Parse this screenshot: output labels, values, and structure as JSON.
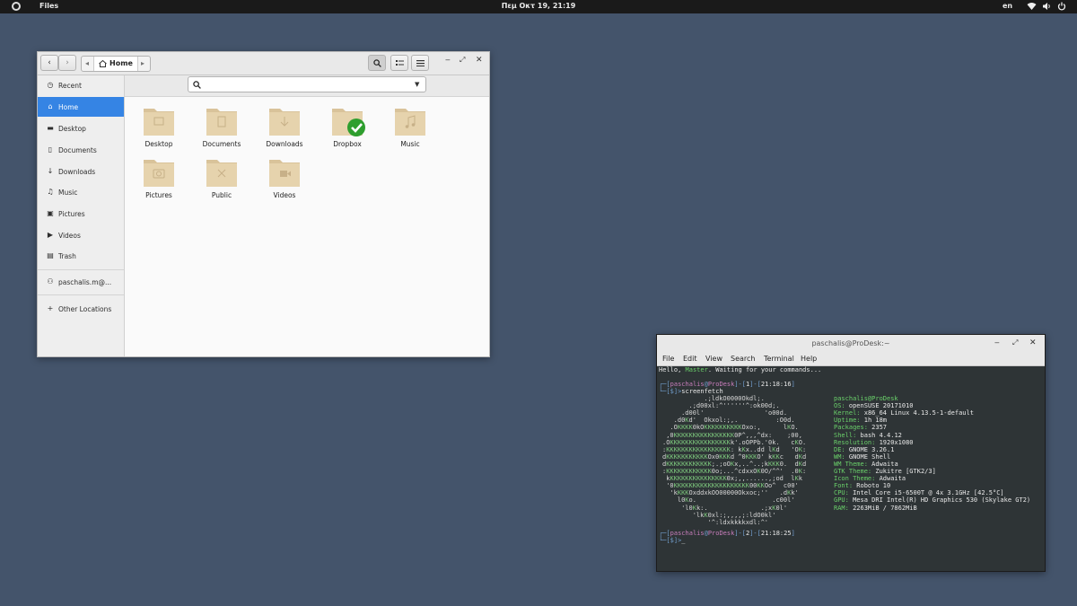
{
  "topbar": {
    "app": "Files",
    "clock": "Πεμ Οκτ 19, 21:19",
    "lang": "en",
    "icons": [
      "activities-icon",
      "network-icon",
      "volume-icon",
      "power-icon"
    ]
  },
  "files": {
    "path_label": "Home",
    "sidebar": [
      {
        "label": "Recent",
        "icon": "clock-icon"
      },
      {
        "label": "Home",
        "icon": "home-icon",
        "active": true
      },
      {
        "label": "Desktop",
        "icon": "desktop-icon"
      },
      {
        "label": "Documents",
        "icon": "document-icon"
      },
      {
        "label": "Downloads",
        "icon": "download-icon"
      },
      {
        "label": "Music",
        "icon": "music-icon"
      },
      {
        "label": "Pictures",
        "icon": "camera-icon"
      },
      {
        "label": "Videos",
        "icon": "video-icon"
      },
      {
        "label": "Trash",
        "icon": "trash-icon"
      },
      {
        "label": "paschalis.m@...",
        "icon": "network-drive-icon"
      },
      {
        "label": "Other Locations",
        "icon": "plus-icon"
      }
    ],
    "folders": [
      {
        "label": "Desktop",
        "icon": "desktop-folder-icon"
      },
      {
        "label": "Documents",
        "icon": "documents-folder-icon"
      },
      {
        "label": "Downloads",
        "icon": "downloads-folder-icon"
      },
      {
        "label": "Dropbox",
        "icon": "dropbox-folder-icon"
      },
      {
        "label": "Music",
        "icon": "music-folder-icon"
      },
      {
        "label": "Pictures",
        "icon": "pictures-folder-icon"
      },
      {
        "label": "Public",
        "icon": "public-folder-icon"
      },
      {
        "label": "Videos",
        "icon": "videos-folder-icon"
      }
    ],
    "colors": {
      "accent": "#3584e4",
      "folder": "#e3cfa9",
      "check": "#2e9e2e"
    }
  },
  "terminal": {
    "title": "paschalis@ProDesk:~",
    "menu": [
      "File",
      "Edit",
      "View",
      "Search",
      "Terminal",
      "Help"
    ],
    "greeting": {
      "pre": "Hello, ",
      "name": "Master",
      "post": ". Waiting for your commands..."
    },
    "prompt1": {
      "user": "paschalis",
      "host": "ProDesk",
      "num": "1",
      "time": "21:18:16",
      "cmd": "screenfetch"
    },
    "prompt2": {
      "user": "paschalis",
      "host": "ProDesk",
      "num": "2",
      "time": "21:18:25",
      "cmd": "_"
    },
    "logo": [
      "           .;ldkO0000Okdl;.",
      "       .;d00xl:^''''''^:ok00d;.",
      "     .d00l'                'o00d.",
      "   .d0Kd'  Okxol:;,.          :O0d.",
      "  .OKKKK0kOKKKKKKKKKKOxo:,      lKO.",
      " ,0KKKKKKKKKKKKKKKK0P^,,,^dx:    ;00,",
      ".OKKKKKKKKKKKKKKKKk'.oOPPb.'0k.   cKO.",
      ":KKKKKKKKKKKKKKKKK: kKx..dd lKd   'OK:",
      "dKKKKKKKKKKKOx0KKKd ^0KKKO' kKKc   dKd",
      "dKKKKKKKKKKKK;.;oOKx,..^..;kKKK0.  dKd",
      ":KKKKKKKKKKKK0o;...^cdxxOK0O/^^'  .0K:",
      " kKKKKKKKKKKKKKKK0x;,,......,;od  lKk",
      " '0KKKKKKKKKKKKKKKKKKKK00KKOo^  c00'",
      "  'kKKKOxddxkOO00000Okxoc;''   .dKk'",
      "    l0Ko.                    .c00l'",
      "     'l0Kk:.              .;xK0l'",
      "        'lkK0xl:;,,,,;:ldO0kl'",
      "            '^:ldxkkkkxdl:^'"
    ],
    "info": [
      {
        "k": "",
        "v": "paschalis@ProDesk"
      },
      {
        "k": "OS:",
        "v": " openSUSE 20171010"
      },
      {
        "k": "Kernel:",
        "v": " x86_64 Linux 4.13.5-1-default"
      },
      {
        "k": "Uptime:",
        "v": " 1h 18m"
      },
      {
        "k": "Packages:",
        "v": " 2357"
      },
      {
        "k": "Shell:",
        "v": " bash 4.4.12"
      },
      {
        "k": "Resolution:",
        "v": " 1920x1080"
      },
      {
        "k": "DE:",
        "v": " GNOME 3.26.1"
      },
      {
        "k": "WM:",
        "v": " GNOME Shell"
      },
      {
        "k": "WM Theme:",
        "v": " Adwaita"
      },
      {
        "k": "GTK Theme:",
        "v": " Zukitre [GTK2/3]"
      },
      {
        "k": "Icon Theme:",
        "v": " Adwaita"
      },
      {
        "k": "Font:",
        "v": " Roboto 10"
      },
      {
        "k": "CPU:",
        "v": " Intel Core i5-6500T @ 4x 3.1GHz [42.5°C]"
      },
      {
        "k": "GPU:",
        "v": " Mesa DRI Intel(R) HD Graphics 530 (Skylake GT2)"
      },
      {
        "k": "RAM:",
        "v": " 2263MiB / 7862MiB"
      }
    ]
  }
}
